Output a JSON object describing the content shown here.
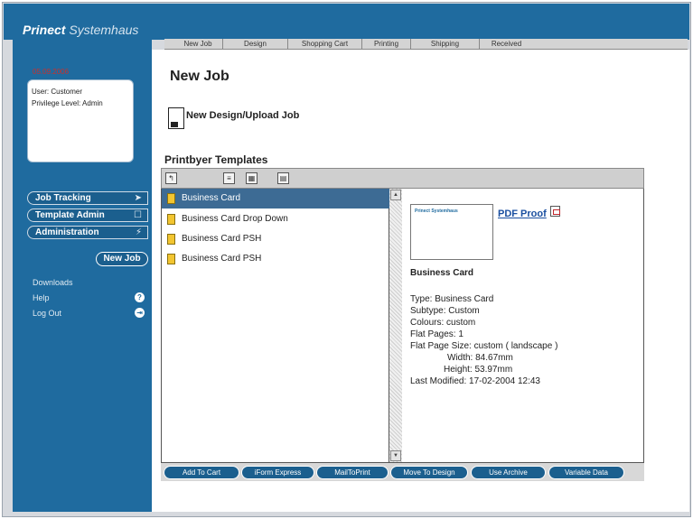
{
  "app": {
    "logo_brand": "Prinect",
    "logo_rest": " Systemhaus"
  },
  "sidebar": {
    "date_line": "05.09.2006",
    "user_line": "User: Customer",
    "privilege_line": "Privilege Level: Admin",
    "nav": [
      {
        "label": "Job Tracking",
        "icon": "arrow-icon"
      },
      {
        "label": "Template Admin",
        "icon": "square-icon"
      },
      {
        "label": "Administration",
        "icon": "wand-icon"
      }
    ],
    "new_job": "New Job",
    "links": [
      {
        "label": "Downloads"
      },
      {
        "label": "Help",
        "icon": "question-icon"
      },
      {
        "label": "Log Out",
        "icon": "logout-icon"
      }
    ]
  },
  "tabs": [
    "New Job",
    "Design",
    "Shopping Cart",
    "Printing",
    "Shipping",
    "Received"
  ],
  "main": {
    "title": "New Job",
    "new_design": "New Design/Upload Job",
    "templates_title": "Printbyer Templates"
  },
  "templates": [
    {
      "label": "Business Card",
      "selected": true,
      "double": false
    },
    {
      "label": "Business Card Drop Down",
      "selected": false,
      "double": false
    },
    {
      "label": "Business Card PSH",
      "selected": false,
      "double": true
    },
    {
      "label": "Business Card PSH",
      "selected": false,
      "double": true
    }
  ],
  "detail": {
    "pdf_proof": "PDF Proof",
    "title": "Business Card",
    "type": "Type: Business Card",
    "subtype": "Subtype: Custom",
    "colours": "Colours: custom",
    "flat_pages": "Flat Pages: 1",
    "flat_page_size": "Flat Page Size:  custom ( landscape )",
    "width": "Width:  84.67mm",
    "height": "Height:  53.97mm",
    "last_modified": "Last Modified: 17-02-2004 12:43",
    "thumb_logo": "Prinect Systemhaus"
  },
  "actions": [
    "Add To Cart",
    "iForm Express",
    "MailToPrint",
    "Move To Design",
    "Use Archive",
    "Variable Data"
  ],
  "colors": {
    "brand_blue": "#1f6b9f",
    "selected_row": "#3d6b94"
  }
}
